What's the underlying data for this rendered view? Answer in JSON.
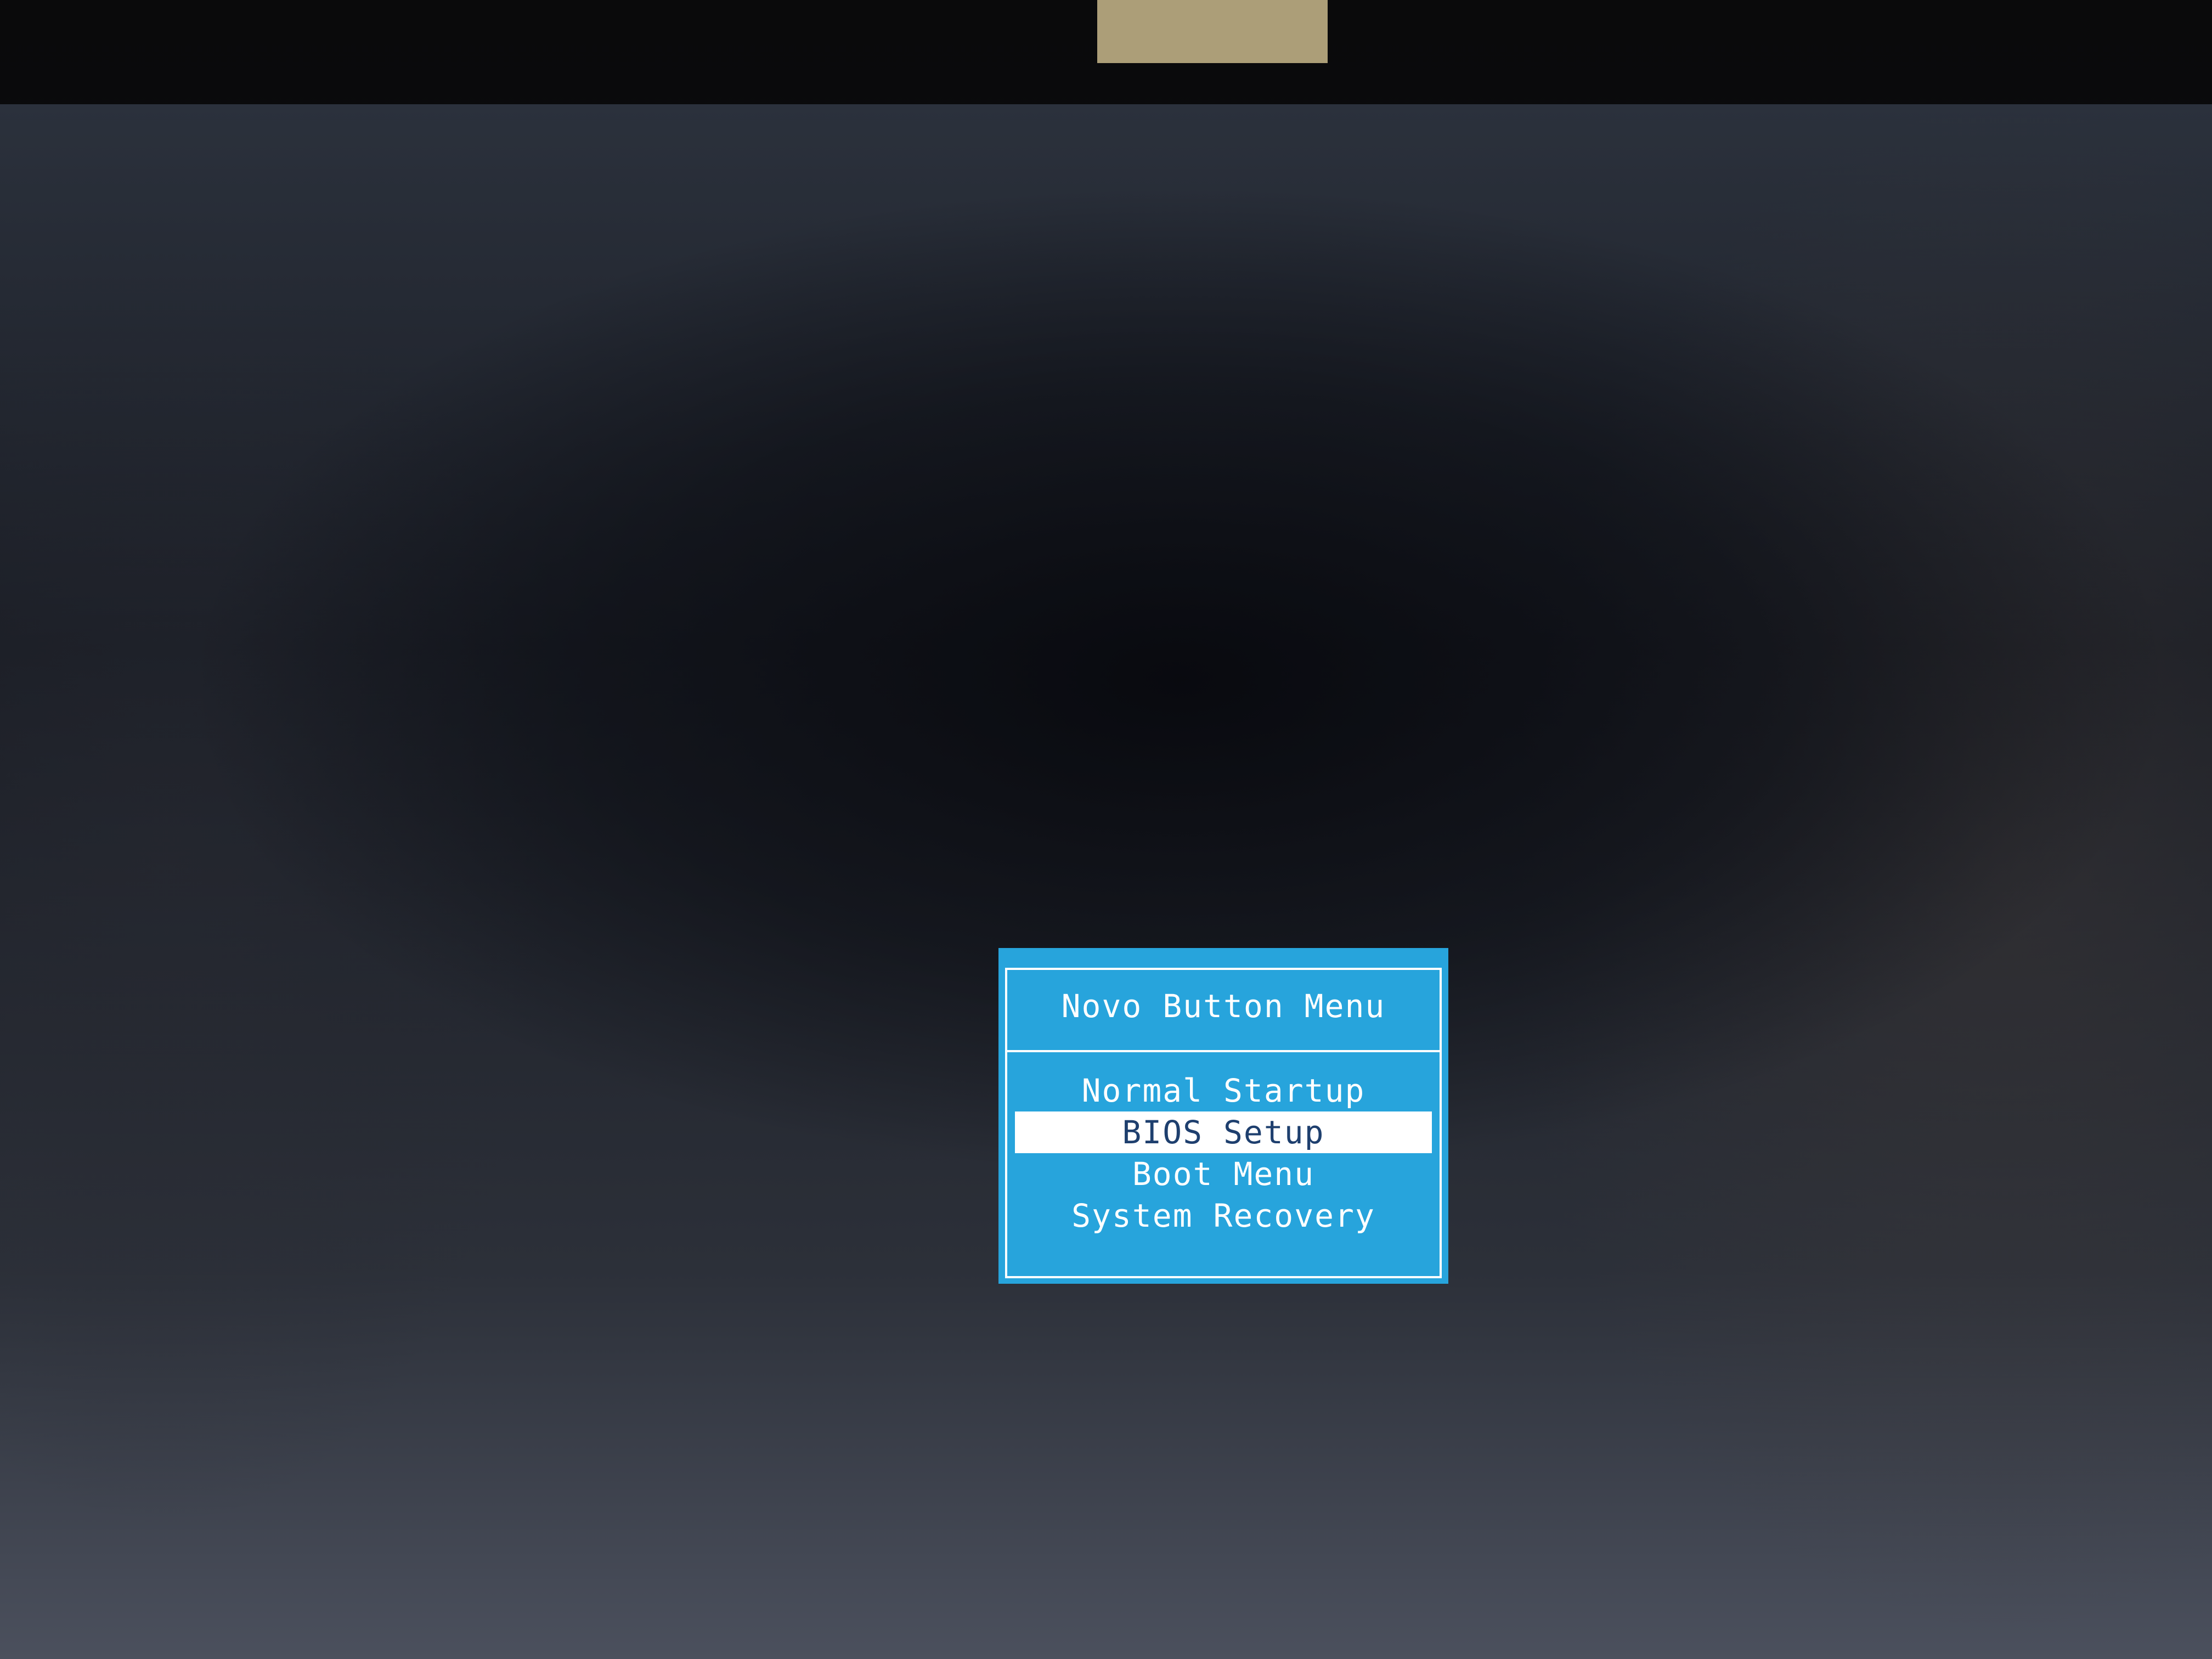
{
  "menu": {
    "title": "Novo Button Menu",
    "items": [
      {
        "label": "Normal Startup",
        "selected": false
      },
      {
        "label": "BIOS Setup",
        "selected": true
      },
      {
        "label": "Boot Menu",
        "selected": false
      },
      {
        "label": "System Recovery",
        "selected": false
      }
    ]
  },
  "colors": {
    "menu_background": "#27a4dc",
    "menu_text": "#ffffff",
    "selection_background": "#ffffff",
    "selection_text": "#1e3f6e",
    "screen_background": "#1a1d25"
  }
}
